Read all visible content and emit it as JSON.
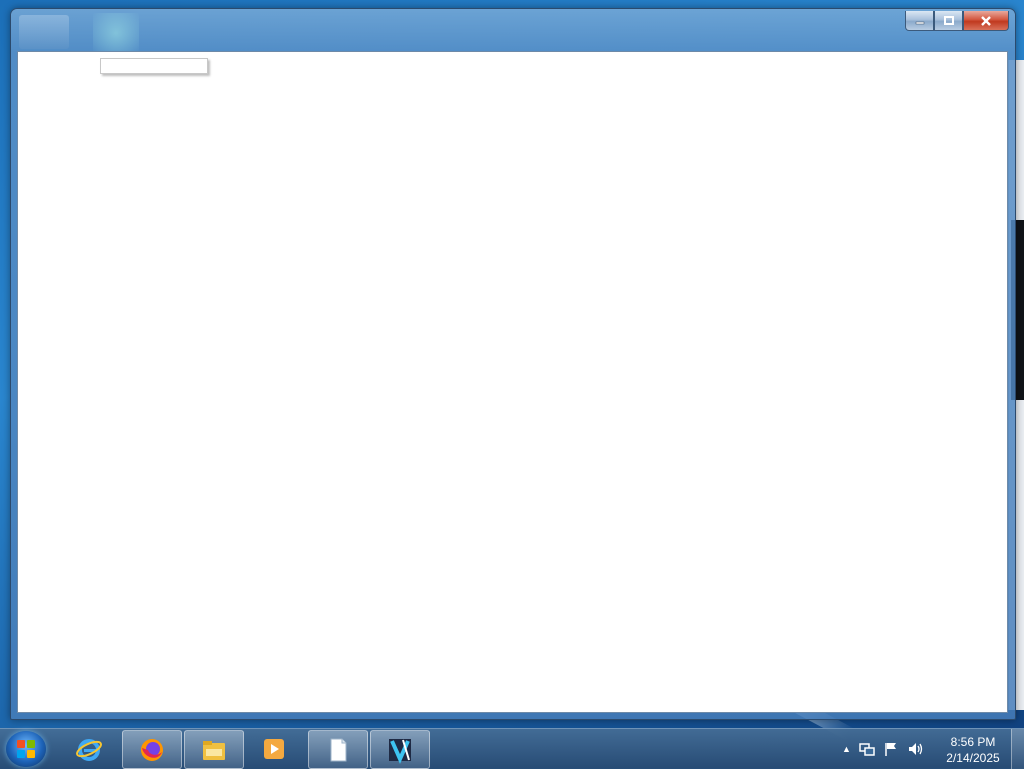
{
  "window": {
    "caption_buttons": {
      "minimize_icon": "minimize-icon",
      "maximize_icon": "maximize-icon",
      "close_icon": "close-icon"
    }
  },
  "taskbar": {
    "pinned": [
      {
        "name": "internet-explorer",
        "icon": "ie-icon",
        "active": false
      },
      {
        "name": "firefox",
        "icon": "firefox-icon",
        "active": true
      },
      {
        "name": "file-explorer",
        "icon": "folder-icon",
        "active": true
      },
      {
        "name": "media-player",
        "icon": "media-player-icon",
        "active": false
      },
      {
        "name": "document",
        "icon": "document-icon",
        "active": true
      },
      {
        "name": "video-editor",
        "icon": "video-editor-icon",
        "active": true
      }
    ],
    "tray": {
      "show_hidden_icon": "▲",
      "network_icon": "network-icon",
      "action_center_icon": "flag-icon",
      "volume_icon": "volume-icon"
    },
    "clock": {
      "time": "8:56 PM",
      "date": "2/14/2025"
    }
  },
  "colors": {
    "close_red": "#c0391f",
    "taskbar": "#2f5a86",
    "desktop": "#1c6fb8"
  }
}
